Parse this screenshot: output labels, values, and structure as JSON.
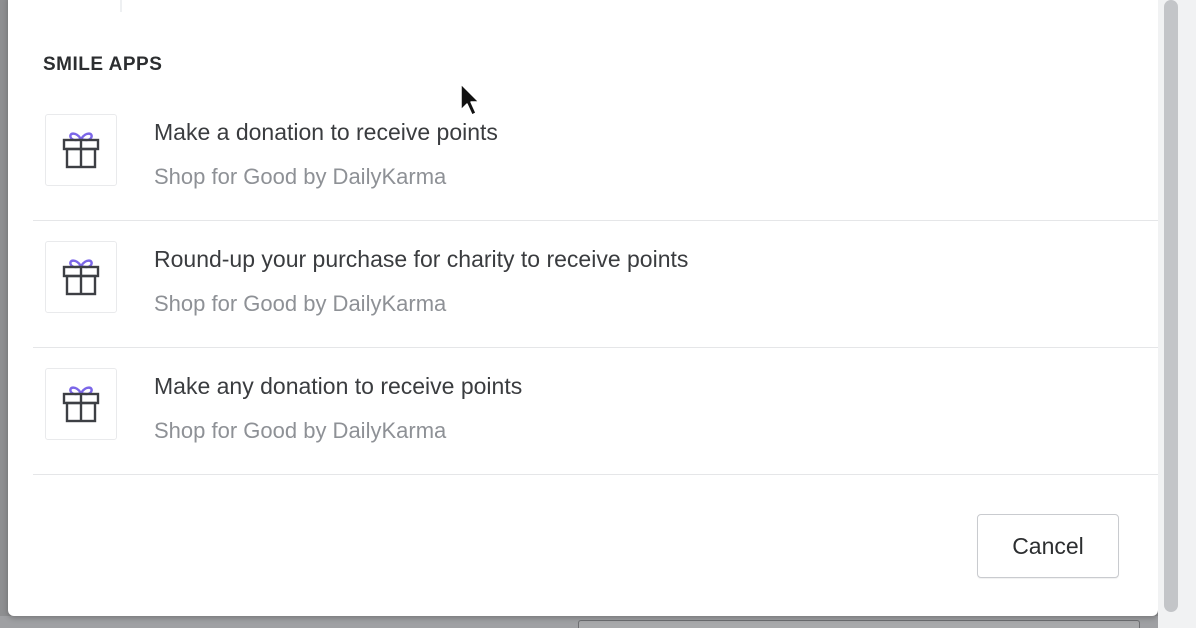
{
  "section": {
    "heading": "SMILE APPS"
  },
  "apps": [
    {
      "title": "Make a donation to receive points",
      "subtitle": "Shop for Good by DailyKarma",
      "icon": "gift-icon"
    },
    {
      "title": "Round-up your purchase for charity to receive points",
      "subtitle": "Shop for Good by DailyKarma",
      "icon": "gift-icon"
    },
    {
      "title": "Make any donation to receive points",
      "subtitle": "Shop for Good by DailyKarma",
      "icon": "gift-icon"
    }
  ],
  "footer": {
    "cancel_label": "Cancel"
  },
  "colors": {
    "icon_outline": "#3d3f44",
    "icon_ribbon": "#7b66e8"
  }
}
